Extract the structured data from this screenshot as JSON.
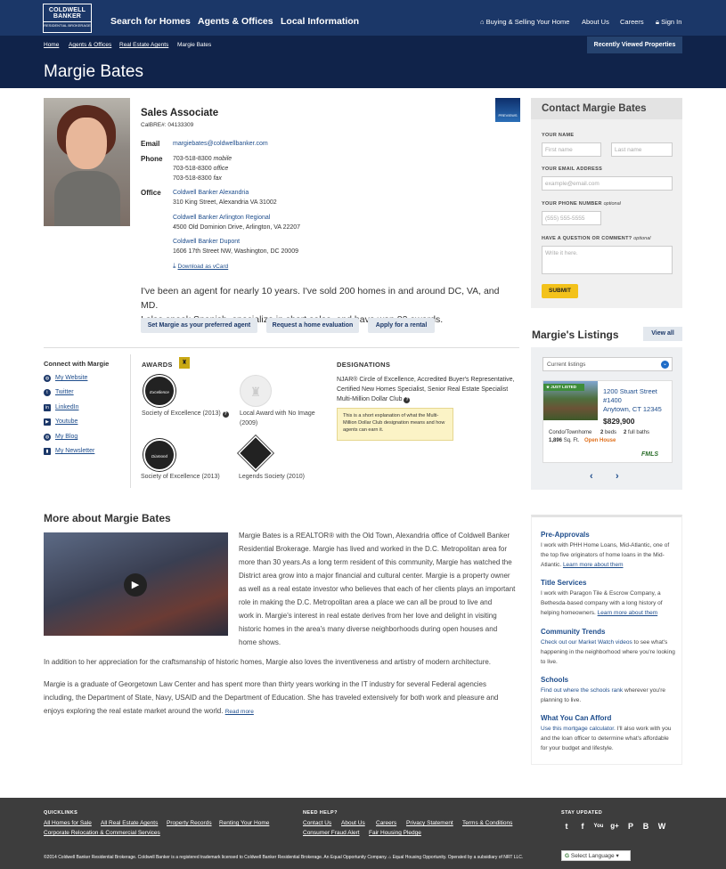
{
  "header": {
    "logo_text": "COLDWELL BANKER",
    "logo_sub": "RESIDENTIAL BROKERAGE",
    "nav": [
      "Search for Homes",
      "Agents & Offices",
      "Local Information"
    ],
    "util": [
      "Buying & Selling Your Home",
      "About Us",
      "Careers",
      "Sign In"
    ]
  },
  "breadcrumb": [
    "Home",
    "Agents & Offices",
    "Real Estate Agents",
    "Margie Bates"
  ],
  "recently_viewed": "Recently Viewed Properties",
  "page_title": "Margie Bates",
  "profile": {
    "role": "Sales Associate",
    "calbre": "CalBRE#: 04133309",
    "email_label": "Email",
    "email": "margiebates@coldwellbanker.com",
    "phone_label": "Phone",
    "phones": [
      {
        "num": "703-518-8300",
        "type": "mobile"
      },
      {
        "num": "703-518-8300",
        "type": "office"
      },
      {
        "num": "703-518-8300",
        "type": "fax"
      }
    ],
    "office_label": "Office",
    "offices": [
      {
        "name": "Coldwell Banker Alexandria",
        "addr": "310 King Street, Alexandria VA 31002"
      },
      {
        "name": "Coldwell Banker Arlington Regional",
        "addr": "4500 Old Dominion Drive, Arlington, VA 22207"
      },
      {
        "name": "Coldwell Banker Dupont",
        "addr": "1606 17th Street NW, Washington, DC 20009"
      }
    ],
    "vcard": "Download as vCard",
    "previews_badge": "PREVIEWS",
    "bio_line1": "I've been an agent for nearly 10 years. I've sold 200 homes in and around DC, VA, and MD.",
    "bio_line2": "I also speak Spanish, specialize in short sales, and have won 82 awards.",
    "buttons": [
      "Set Margie as your preferred agent",
      "Request a home evaluation",
      "Apply for a rental"
    ]
  },
  "contact": {
    "title": "Contact Margie Bates",
    "name_label": "YOUR NAME",
    "first_ph": "First name",
    "last_ph": "Last name",
    "email_label": "YOUR EMAIL ADDRESS",
    "email_ph": "example@email.com",
    "phone_label": "YOUR PHONE NUMBER",
    "phone_opt": "optional",
    "phone_ph": "(555) 555-5555",
    "question_label": "HAVE A QUESTION OR COMMENT?",
    "question_opt": "optional",
    "question_ph": "Write it here.",
    "submit": "SUBMIT"
  },
  "listings": {
    "title": "Margie's Listings",
    "view_all": "View all",
    "select": "Current listings",
    "badge": "JUST LISTED",
    "addr1": "1200 Stuart Street",
    "addr2": "#1400",
    "city": "Anytown, CT 12345",
    "price": "$829,900",
    "type": "Condo/Townhome",
    "beds_n": "2",
    "beds": "beds",
    "baths_n": "2",
    "baths": "full baths",
    "sqft_n": "1,896",
    "sqft": "Sq. Ft.",
    "status": "Open House",
    "mls": "FMLS"
  },
  "connect": {
    "title": "Connect with Margie",
    "links": [
      "My Website",
      "Twitter",
      "LinkedIn",
      "Youtube",
      "My Blog",
      "My Newsletter"
    ]
  },
  "awards": {
    "title": "AWARDS",
    "items": [
      "Society of Excellence (2013)",
      "Local Award with No Image",
      "(2009)",
      "Society of Excellence (2013)",
      "Legends Society (2010)"
    ]
  },
  "designations": {
    "title": "DESIGNATIONS",
    "line1": "NJAR® Circle of Excellence,  Accredited Buyer's Representative,",
    "line2": "Certified New Homes Specialist, Senior Real Estate Specialist",
    "line3": "Multi-Million Dollar Club",
    "tooltip": "This is a short explanation of what the Multi-Million Dollar Club designation means and how agents can earn it."
  },
  "more": {
    "title": "More about Margie Bates",
    "p1_lines": [
      "Margie Bates is a REALTOR® with the Old Town, Alexandria office of Coldwell Banker",
      "Residential Brokerage. Margie has lived and worked in the D.C. Metropolitan area for",
      "more than 30 years.As a long term resident of this community, Margie has watched the",
      "District area grow into a major financial and cultural center. Margie is a property owner",
      "as well as a real estate investor who believes that each of her clients plays an important",
      "role in making the D.C. Metropolitan area a place we can all be proud to live and",
      "work in.  Margie's interest in real estate derives from her love and delight in visiting",
      "historic homes in the area's many diverse neighborhoods during open houses and",
      "home shows."
    ],
    "p2": "In addition to her appreciation for the craftsmanship of historic homes, Margie also loves the inventiveness and artistry of modern architecture.",
    "p3_lines": [
      "Margie is a graduate of Georgetown Law Center and has spent more than thirty years working in the IT industry for several Federal agencies",
      "including, the Department of State, Navy, USAID and the Department of Education. She has traveled extensively for both work and pleasure and",
      "enjoys exploring the real estate market around the world."
    ],
    "read_more": "Read more"
  },
  "info": [
    {
      "title": "Pre-Approvals",
      "text": "I work with PHH Home Loans, Mid-Atlantic, one of the top five originators of home loans in the Mid-Atlantic.",
      "link": "Learn more about them",
      "link_first": false
    },
    {
      "title": "Title Services",
      "text": "I work with Paragon Tile & Escrow Company, a Bethesda-based company with a long history of helping homeowners.",
      "link": "Learn more about them",
      "link_first": false
    },
    {
      "title": "Community Trends",
      "text": "to see what's happening in the neighborhood where you're looking to live.",
      "link": "Check out our Market Watch videos",
      "link_first": true
    },
    {
      "title": "Schools",
      "text": "wherever you're planning to live.",
      "link": "Find out where the schools rank",
      "link_first": true
    },
    {
      "title": "What You Can Afford",
      "text": "I'll also work with you and the loan officer to determine what's affordable for your budget and lifestyle.",
      "link": "Use this mortgage calculator.",
      "link_first": true
    }
  ],
  "footer": {
    "quicklinks_title": "QUICKLINKS",
    "quicklinks": [
      "All Homes for Sale",
      "All Real Estate Agents",
      "Property Records",
      "Renting Your Home",
      "Corporate Relocation & Commercial Services"
    ],
    "help_title": "NEED HELP?",
    "help": [
      "Contact Us",
      "About Us",
      "Careers",
      "Privacy Statement",
      "Terms & Conditions",
      "Consumer Fraud Alert",
      "Fair Housing Pledge"
    ],
    "stay_title": "STAY UPDATED",
    "social": [
      "twitter-icon",
      "facebook-icon",
      "youtube-icon",
      "google-plus-icon",
      "pinterest-icon",
      "blogger-icon",
      "wordpress-icon"
    ],
    "copyright": "©2014 Coldwell Banker Residential Brokerage. Coldwell Banker is a registered trademark licensed to Coldwell Banker Residential Brokerage. An Equal Opportunity Company.",
    "equal_housing": "Equal Housing Opportunity. Operated by a subsidiary of NRT LLC.",
    "language": "Select Language"
  },
  "colors": {
    "nav_blue": "#1b3768",
    "band_blue": "#10234a",
    "link": "#1e4d8c",
    "submit": "#f3c21b",
    "just_listed": "#3e8d3a",
    "open_house": "#e0701c"
  }
}
